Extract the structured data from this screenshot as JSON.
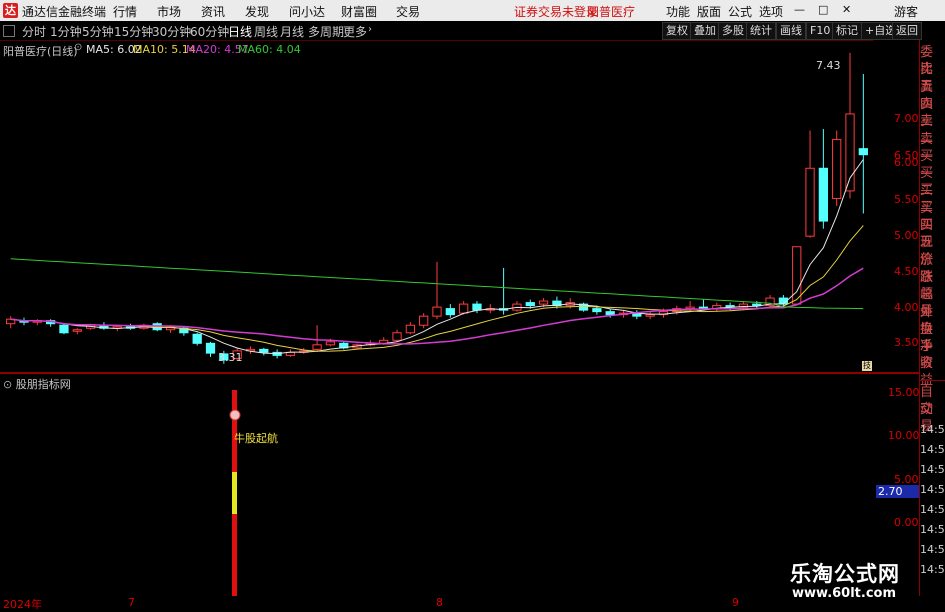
{
  "app": {
    "logo": "达",
    "title": "通达信金融终端",
    "menus": [
      "行情",
      "市场",
      "资讯",
      "发现",
      "问小达",
      "财富圈",
      "交易"
    ],
    "warning": "证券交易未登录",
    "stock_name": "阳普医疗",
    "right_menus": [
      "功能",
      "版面",
      "公式",
      "选项"
    ],
    "user": "游客",
    "window_controls": [
      "—",
      "□",
      "✕"
    ]
  },
  "periods": [
    "分时",
    "1分钟",
    "5分钟",
    "15分钟",
    "30分钟",
    "60分钟",
    "日线",
    "周线",
    "月线",
    "多周期",
    "更多"
  ],
  "active_period": "日线",
  "toolbar": [
    "复权",
    "叠加",
    "多股",
    "统计",
    "画线",
    "F10",
    "标记",
    "+自选",
    "返回"
  ],
  "main_chart": {
    "title": "阳普医疗(日线)",
    "ma": [
      {
        "label": "MA5: 6.02",
        "color": "#e6e6e6"
      },
      {
        "label": "MA10: 5.14",
        "color": "#e6d23c"
      },
      {
        "label": "MA20: 4.57",
        "color": "#d23cd2"
      },
      {
        "label": "MA60: 4.04",
        "color": "#32c832"
      }
    ],
    "high_label": "7.43",
    "low_label": "3.31",
    "yticks": [
      "7.00",
      "6.50",
      "6.00",
      "5.50",
      "5.00",
      "4.50",
      "4.00",
      "3.50"
    ],
    "corner_badge": "技"
  },
  "order_panel": [
    "委比",
    "卖五",
    "卖四",
    "卖三",
    "卖二",
    "卖一",
    "买一",
    "买二",
    "买三",
    "买四",
    "买五",
    "现价",
    "涨跌",
    "涨幅",
    "总量",
    "外盘",
    "换手",
    "净资",
    "收益"
  ],
  "sub_chart": {
    "title": "股朋指标网",
    "annotation": "牛股起航",
    "yticks": [
      "15.00",
      "10.00",
      "5.00",
      "2.70",
      "0.00"
    ],
    "current_value": "2.70"
  },
  "trade_panel": {
    "labels": [
      "自动",
      "交易"
    ],
    "times": [
      "14:56",
      "14:56",
      "14:56",
      "14:56",
      "14:56",
      "14:56",
      "14:56",
      "14:56"
    ]
  },
  "dates": [
    "2024年",
    "7",
    "8",
    "9"
  ],
  "watermark": {
    "title": "乐淘公式网",
    "url": "www.60lt.com"
  },
  "chart_data": {
    "type": "candlestick",
    "title": "阳普医疗(日线)",
    "ylim": [
      3.2,
      7.6
    ],
    "candles": [
      {
        "o": 3.84,
        "c": 3.9,
        "h": 3.94,
        "l": 3.78
      },
      {
        "o": 3.88,
        "c": 3.86,
        "h": 3.92,
        "l": 3.82
      },
      {
        "o": 3.86,
        "c": 3.88,
        "h": 3.9,
        "l": 3.82
      },
      {
        "o": 3.88,
        "c": 3.84,
        "h": 3.9,
        "l": 3.8
      },
      {
        "o": 3.82,
        "c": 3.72,
        "h": 3.84,
        "l": 3.7
      },
      {
        "o": 3.74,
        "c": 3.76,
        "h": 3.78,
        "l": 3.7
      },
      {
        "o": 3.78,
        "c": 3.82,
        "h": 3.84,
        "l": 3.76
      },
      {
        "o": 3.82,
        "c": 3.78,
        "h": 3.86,
        "l": 3.76
      },
      {
        "o": 3.78,
        "c": 3.8,
        "h": 3.82,
        "l": 3.74
      },
      {
        "o": 3.8,
        "c": 3.78,
        "h": 3.84,
        "l": 3.76
      },
      {
        "o": 3.78,
        "c": 3.82,
        "h": 3.84,
        "l": 3.76
      },
      {
        "o": 3.84,
        "c": 3.76,
        "h": 3.86,
        "l": 3.74
      },
      {
        "o": 3.76,
        "c": 3.8,
        "h": 3.82,
        "l": 3.72
      },
      {
        "o": 3.78,
        "c": 3.72,
        "h": 3.8,
        "l": 3.68
      },
      {
        "o": 3.7,
        "c": 3.58,
        "h": 3.72,
        "l": 3.55
      },
      {
        "o": 3.58,
        "c": 3.45,
        "h": 3.6,
        "l": 3.4
      },
      {
        "o": 3.44,
        "c": 3.36,
        "h": 3.48,
        "l": 3.31
      },
      {
        "o": 3.38,
        "c": 3.48,
        "h": 3.52,
        "l": 3.36
      },
      {
        "o": 3.48,
        "c": 3.5,
        "h": 3.54,
        "l": 3.44
      },
      {
        "o": 3.5,
        "c": 3.46,
        "h": 3.52,
        "l": 3.42
      },
      {
        "o": 3.46,
        "c": 3.42,
        "h": 3.5,
        "l": 3.38
      },
      {
        "o": 3.42,
        "c": 3.46,
        "h": 3.5,
        "l": 3.4
      },
      {
        "o": 3.46,
        "c": 3.48,
        "h": 3.52,
        "l": 3.44
      },
      {
        "o": 3.5,
        "c": 3.56,
        "h": 3.82,
        "l": 3.48
      },
      {
        "o": 3.56,
        "c": 3.6,
        "h": 3.64,
        "l": 3.54
      },
      {
        "o": 3.58,
        "c": 3.52,
        "h": 3.6,
        "l": 3.5
      },
      {
        "o": 3.52,
        "c": 3.56,
        "h": 3.58,
        "l": 3.5
      },
      {
        "o": 3.56,
        "c": 3.58,
        "h": 3.62,
        "l": 3.54
      },
      {
        "o": 3.58,
        "c": 3.62,
        "h": 3.66,
        "l": 3.56
      },
      {
        "o": 3.62,
        "c": 3.72,
        "h": 3.76,
        "l": 3.6
      },
      {
        "o": 3.72,
        "c": 3.82,
        "h": 3.86,
        "l": 3.7
      },
      {
        "o": 3.82,
        "c": 3.94,
        "h": 3.98,
        "l": 3.78
      },
      {
        "o": 3.94,
        "c": 4.06,
        "h": 4.66,
        "l": 3.9
      },
      {
        "o": 4.04,
        "c": 3.96,
        "h": 4.1,
        "l": 3.92
      },
      {
        "o": 3.98,
        "c": 4.1,
        "h": 4.14,
        "l": 3.96
      },
      {
        "o": 4.1,
        "c": 4.02,
        "h": 4.14,
        "l": 3.98
      },
      {
        "o": 4.02,
        "c": 4.04,
        "h": 4.1,
        "l": 3.98
      },
      {
        "o": 4.04,
        "c": 4.02,
        "h": 4.58,
        "l": 3.96
      },
      {
        "o": 4.02,
        "c": 4.1,
        "h": 4.14,
        "l": 4.0
      },
      {
        "o": 4.12,
        "c": 4.08,
        "h": 4.16,
        "l": 4.04
      },
      {
        "o": 4.1,
        "c": 4.14,
        "h": 4.18,
        "l": 4.06
      },
      {
        "o": 4.14,
        "c": 4.08,
        "h": 4.2,
        "l": 4.04
      },
      {
        "o": 4.08,
        "c": 4.12,
        "h": 4.18,
        "l": 4.04
      },
      {
        "o": 4.1,
        "c": 4.02,
        "h": 4.12,
        "l": 4.0
      },
      {
        "o": 4.04,
        "c": 4.0,
        "h": 4.08,
        "l": 3.96
      },
      {
        "o": 4.0,
        "c": 3.96,
        "h": 4.04,
        "l": 3.92
      },
      {
        "o": 3.96,
        "c": 3.98,
        "h": 4.02,
        "l": 3.92
      },
      {
        "o": 3.98,
        "c": 3.94,
        "h": 4.02,
        "l": 3.9
      },
      {
        "o": 3.94,
        "c": 3.96,
        "h": 4.0,
        "l": 3.9
      },
      {
        "o": 3.96,
        "c": 4.0,
        "h": 4.04,
        "l": 3.92
      },
      {
        "o": 4.0,
        "c": 4.04,
        "h": 4.08,
        "l": 3.96
      },
      {
        "o": 4.04,
        "c": 4.06,
        "h": 4.14,
        "l": 4.0
      },
      {
        "o": 4.06,
        "c": 4.04,
        "h": 4.16,
        "l": 4.02
      },
      {
        "o": 4.04,
        "c": 4.08,
        "h": 4.12,
        "l": 4.0
      },
      {
        "o": 4.08,
        "c": 4.06,
        "h": 4.12,
        "l": 4.02
      },
      {
        "o": 4.06,
        "c": 4.1,
        "h": 4.14,
        "l": 4.02
      },
      {
        "o": 4.1,
        "c": 4.08,
        "h": 4.14,
        "l": 4.04
      },
      {
        "o": 4.08,
        "c": 4.18,
        "h": 4.22,
        "l": 4.06
      },
      {
        "o": 4.18,
        "c": 4.1,
        "h": 4.22,
        "l": 4.06
      },
      {
        "o": 4.1,
        "c": 4.86,
        "h": 4.86,
        "l": 4.08
      },
      {
        "o": 5.0,
        "c": 5.9,
        "h": 6.4,
        "l": 4.98
      },
      {
        "o": 5.9,
        "c": 5.2,
        "h": 6.42,
        "l": 5.1
      },
      {
        "o": 5.5,
        "c": 6.28,
        "h": 6.4,
        "l": 5.4
      },
      {
        "o": 5.6,
        "c": 6.62,
        "h": 7.43,
        "l": 5.5
      },
      {
        "o": 6.16,
        "c": 6.08,
        "h": 7.15,
        "l": 5.3
      }
    ]
  }
}
